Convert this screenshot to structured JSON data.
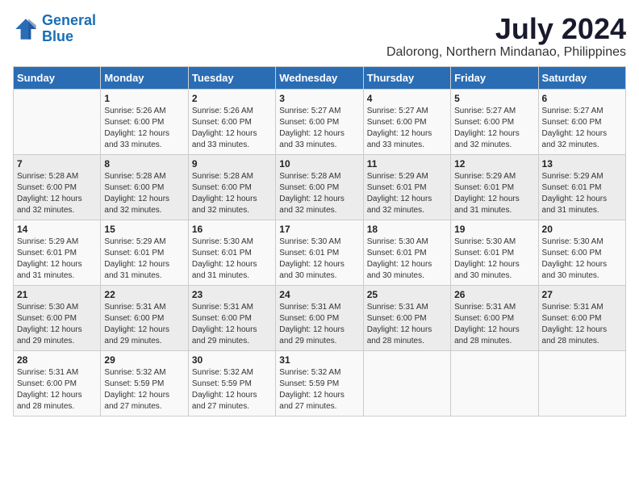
{
  "logo": {
    "line1": "General",
    "line2": "Blue"
  },
  "title": "July 2024",
  "location": "Dalorong, Northern Mindanao, Philippines",
  "days_header": [
    "Sunday",
    "Monday",
    "Tuesday",
    "Wednesday",
    "Thursday",
    "Friday",
    "Saturday"
  ],
  "weeks": [
    [
      {
        "day": "",
        "info": ""
      },
      {
        "day": "1",
        "info": "Sunrise: 5:26 AM\nSunset: 6:00 PM\nDaylight: 12 hours\nand 33 minutes."
      },
      {
        "day": "2",
        "info": "Sunrise: 5:26 AM\nSunset: 6:00 PM\nDaylight: 12 hours\nand 33 minutes."
      },
      {
        "day": "3",
        "info": "Sunrise: 5:27 AM\nSunset: 6:00 PM\nDaylight: 12 hours\nand 33 minutes."
      },
      {
        "day": "4",
        "info": "Sunrise: 5:27 AM\nSunset: 6:00 PM\nDaylight: 12 hours\nand 33 minutes."
      },
      {
        "day": "5",
        "info": "Sunrise: 5:27 AM\nSunset: 6:00 PM\nDaylight: 12 hours\nand 32 minutes."
      },
      {
        "day": "6",
        "info": "Sunrise: 5:27 AM\nSunset: 6:00 PM\nDaylight: 12 hours\nand 32 minutes."
      }
    ],
    [
      {
        "day": "7",
        "info": "Sunrise: 5:28 AM\nSunset: 6:00 PM\nDaylight: 12 hours\nand 32 minutes."
      },
      {
        "day": "8",
        "info": "Sunrise: 5:28 AM\nSunset: 6:00 PM\nDaylight: 12 hours\nand 32 minutes."
      },
      {
        "day": "9",
        "info": "Sunrise: 5:28 AM\nSunset: 6:00 PM\nDaylight: 12 hours\nand 32 minutes."
      },
      {
        "day": "10",
        "info": "Sunrise: 5:28 AM\nSunset: 6:00 PM\nDaylight: 12 hours\nand 32 minutes."
      },
      {
        "day": "11",
        "info": "Sunrise: 5:29 AM\nSunset: 6:01 PM\nDaylight: 12 hours\nand 32 minutes."
      },
      {
        "day": "12",
        "info": "Sunrise: 5:29 AM\nSunset: 6:01 PM\nDaylight: 12 hours\nand 31 minutes."
      },
      {
        "day": "13",
        "info": "Sunrise: 5:29 AM\nSunset: 6:01 PM\nDaylight: 12 hours\nand 31 minutes."
      }
    ],
    [
      {
        "day": "14",
        "info": "Sunrise: 5:29 AM\nSunset: 6:01 PM\nDaylight: 12 hours\nand 31 minutes."
      },
      {
        "day": "15",
        "info": "Sunrise: 5:29 AM\nSunset: 6:01 PM\nDaylight: 12 hours\nand 31 minutes."
      },
      {
        "day": "16",
        "info": "Sunrise: 5:30 AM\nSunset: 6:01 PM\nDaylight: 12 hours\nand 31 minutes."
      },
      {
        "day": "17",
        "info": "Sunrise: 5:30 AM\nSunset: 6:01 PM\nDaylight: 12 hours\nand 30 minutes."
      },
      {
        "day": "18",
        "info": "Sunrise: 5:30 AM\nSunset: 6:01 PM\nDaylight: 12 hours\nand 30 minutes."
      },
      {
        "day": "19",
        "info": "Sunrise: 5:30 AM\nSunset: 6:01 PM\nDaylight: 12 hours\nand 30 minutes."
      },
      {
        "day": "20",
        "info": "Sunrise: 5:30 AM\nSunset: 6:00 PM\nDaylight: 12 hours\nand 30 minutes."
      }
    ],
    [
      {
        "day": "21",
        "info": "Sunrise: 5:30 AM\nSunset: 6:00 PM\nDaylight: 12 hours\nand 29 minutes."
      },
      {
        "day": "22",
        "info": "Sunrise: 5:31 AM\nSunset: 6:00 PM\nDaylight: 12 hours\nand 29 minutes."
      },
      {
        "day": "23",
        "info": "Sunrise: 5:31 AM\nSunset: 6:00 PM\nDaylight: 12 hours\nand 29 minutes."
      },
      {
        "day": "24",
        "info": "Sunrise: 5:31 AM\nSunset: 6:00 PM\nDaylight: 12 hours\nand 29 minutes."
      },
      {
        "day": "25",
        "info": "Sunrise: 5:31 AM\nSunset: 6:00 PM\nDaylight: 12 hours\nand 28 minutes."
      },
      {
        "day": "26",
        "info": "Sunrise: 5:31 AM\nSunset: 6:00 PM\nDaylight: 12 hours\nand 28 minutes."
      },
      {
        "day": "27",
        "info": "Sunrise: 5:31 AM\nSunset: 6:00 PM\nDaylight: 12 hours\nand 28 minutes."
      }
    ],
    [
      {
        "day": "28",
        "info": "Sunrise: 5:31 AM\nSunset: 6:00 PM\nDaylight: 12 hours\nand 28 minutes."
      },
      {
        "day": "29",
        "info": "Sunrise: 5:32 AM\nSunset: 5:59 PM\nDaylight: 12 hours\nand 27 minutes."
      },
      {
        "day": "30",
        "info": "Sunrise: 5:32 AM\nSunset: 5:59 PM\nDaylight: 12 hours\nand 27 minutes."
      },
      {
        "day": "31",
        "info": "Sunrise: 5:32 AM\nSunset: 5:59 PM\nDaylight: 12 hours\nand 27 minutes."
      },
      {
        "day": "",
        "info": ""
      },
      {
        "day": "",
        "info": ""
      },
      {
        "day": "",
        "info": ""
      }
    ]
  ]
}
